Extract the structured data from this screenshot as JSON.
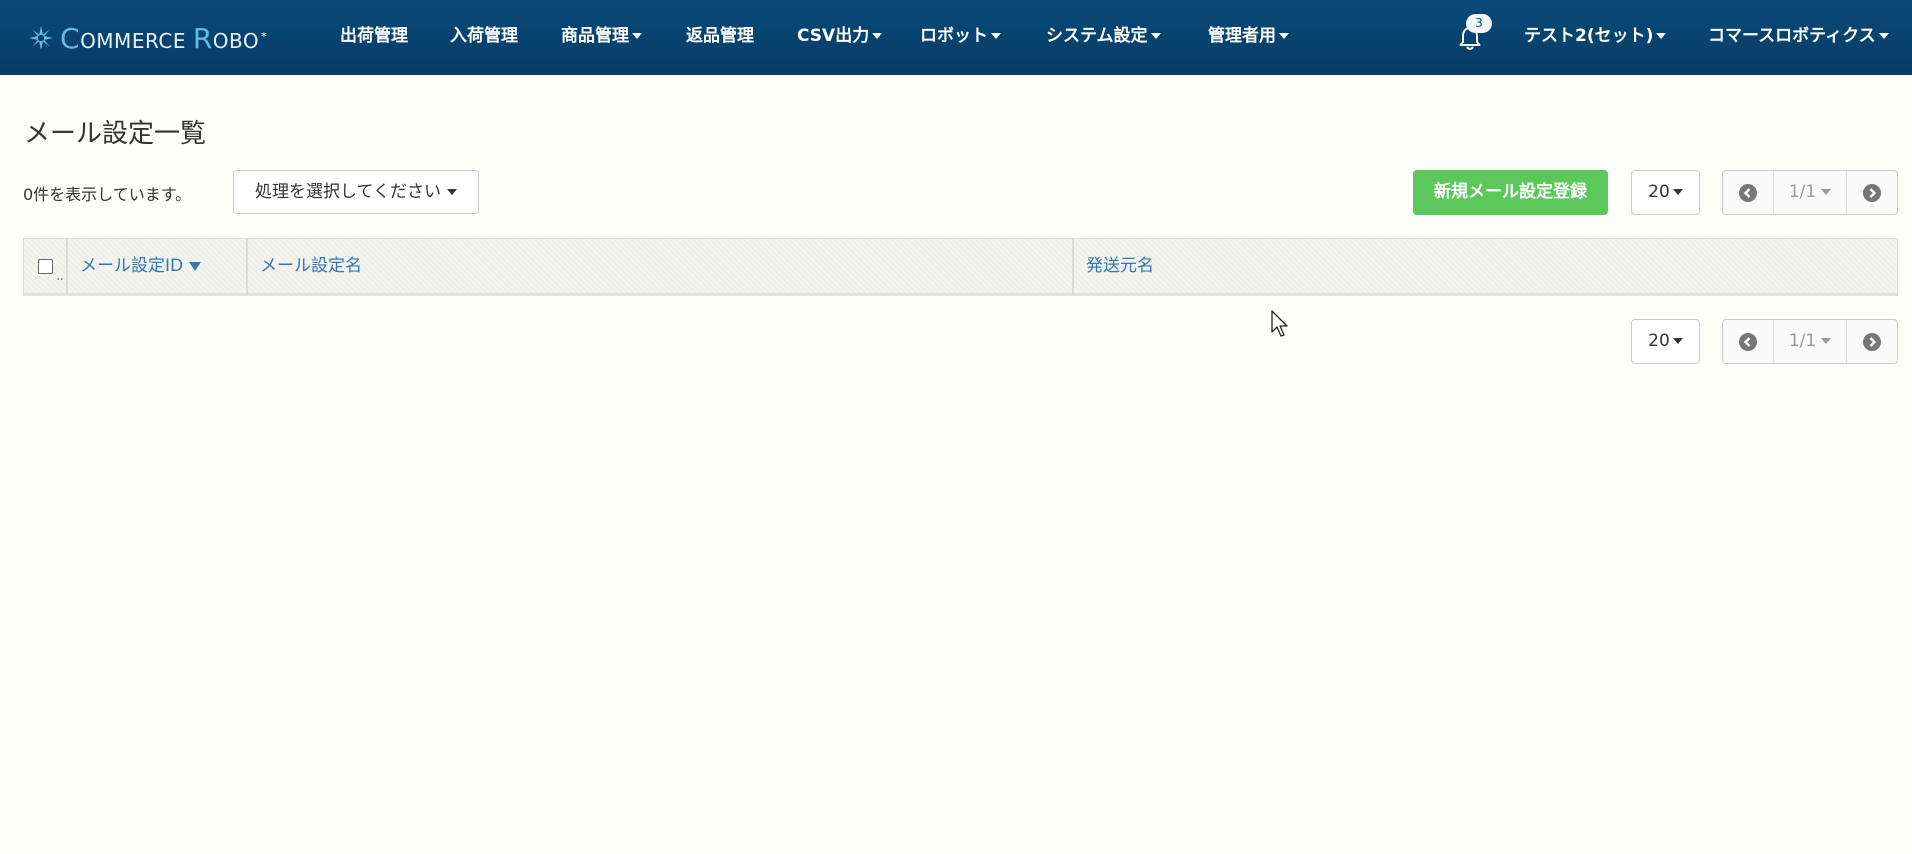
{
  "navbar": {
    "logo": {
      "text_c": "C",
      "text_1": "OMMERCE ",
      "text_r": "R",
      "text_2": "OBO",
      "mark": "*",
      "icon": "commerce-robo-logo-icon"
    },
    "items": [
      {
        "label": "出荷管理",
        "dropdown": false
      },
      {
        "label": "入荷管理",
        "dropdown": false
      },
      {
        "label": "商品管理",
        "dropdown": true
      },
      {
        "label": "返品管理",
        "dropdown": false
      },
      {
        "label": "CSV出力",
        "dropdown": true
      },
      {
        "label": "ロボット",
        "dropdown": true
      },
      {
        "label": "システム設定",
        "dropdown": true
      },
      {
        "label": "管理者用",
        "dropdown": true
      }
    ],
    "notifications": {
      "icon": "bell-icon",
      "count": "3"
    },
    "user": "テスト2(セット)",
    "company": "コマースロボティクス"
  },
  "page": {
    "title": "メール設定一覧",
    "count_text": "0件を表示しています。",
    "action_select": "処理を選択してください",
    "new_button": "新規メール設定登録"
  },
  "pagination": {
    "per_page": "20",
    "page": "1/1"
  },
  "table": {
    "columns": [
      {
        "label": "メール設定ID",
        "sorted": "desc"
      },
      {
        "label": "メール設定名"
      },
      {
        "label": "発送元名"
      }
    ],
    "rows": []
  },
  "colors": {
    "navbar": "#0a4a78",
    "accent_green": "#5cc85c",
    "link_blue": "#3577b5",
    "background": "#fdfdfa"
  }
}
